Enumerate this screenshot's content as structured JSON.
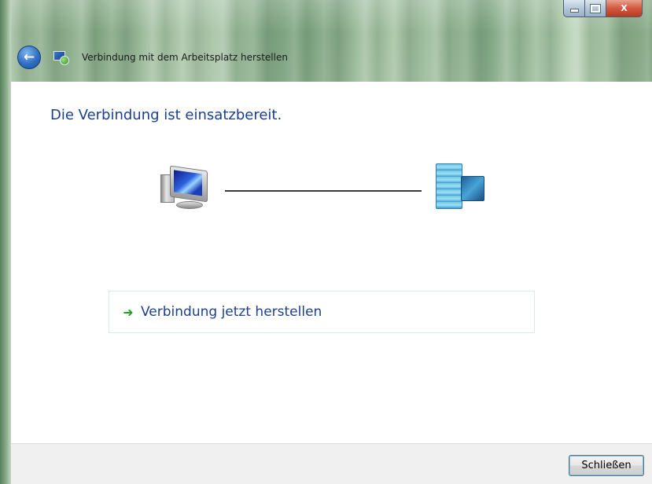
{
  "window": {
    "title": "Verbindung mit dem Arbeitsplatz herstellen",
    "controls": {
      "minimize_icon": "minimize-icon",
      "maximize_icon": "maximize-icon",
      "close_icon": "close-icon",
      "close_glyph": "X"
    },
    "back_glyph": "←"
  },
  "main": {
    "heading": "Die Verbindung ist einsatzbereit.",
    "diagram": {
      "left_icon": "computer-icon",
      "right_icon": "server-icon"
    },
    "action": {
      "arrow_glyph": "➜",
      "label": "Verbindung jetzt herstellen"
    }
  },
  "footer": {
    "close_button_label": "Schließen"
  },
  "colors": {
    "heading": "#1a3e91",
    "action_arrow": "#21a326",
    "footer_bg": "#f0f0f0"
  }
}
